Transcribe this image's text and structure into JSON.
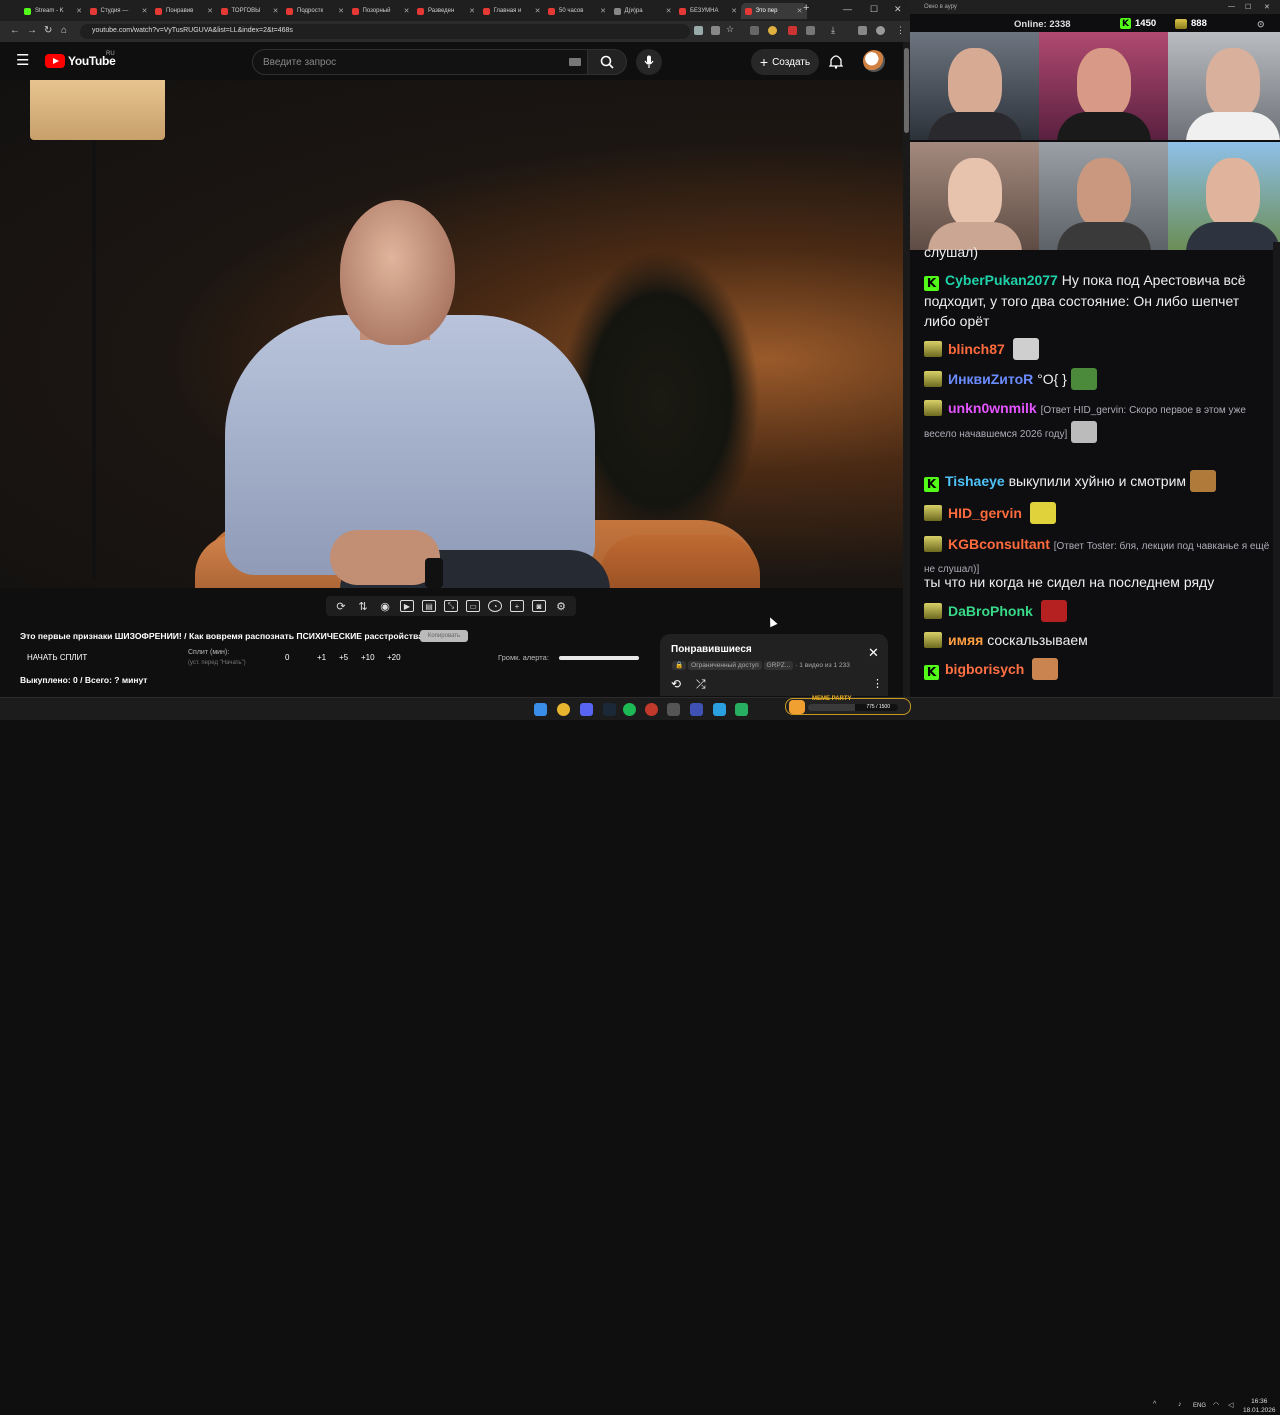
{
  "browser": {
    "tabs": [
      {
        "label": "Stream - K",
        "color": "#53fc18"
      },
      {
        "label": "Студия —",
        "color": "#e53935"
      },
      {
        "label": "Понравив",
        "color": "#e53935"
      },
      {
        "label": "ТОРГОВЫ",
        "color": "#e53935"
      },
      {
        "label": "Подростк",
        "color": "#e53935"
      },
      {
        "label": "Позорный",
        "color": "#e53935"
      },
      {
        "label": "Разведен",
        "color": "#e53935"
      },
      {
        "label": "Главная и",
        "color": "#e53935"
      },
      {
        "label": "50 часов",
        "color": "#e53935"
      },
      {
        "label": "Д(и)ра",
        "color": "#888888"
      },
      {
        "label": "БЕЗУМНА",
        "color": "#e53935"
      },
      {
        "label": "Это пер",
        "color": "#e53935"
      }
    ],
    "url": "youtube.com/watch?v=VyTusRUGUVA&list=LL&index=2&t=468s"
  },
  "youtube": {
    "logo_text": "YouTube",
    "region": "RU",
    "search_placeholder": "Введите запрос",
    "create_label": "Создать"
  },
  "overlay": {
    "title": "Это первые признаки ШИЗОФРЕНИИ! / Как вовремя распознать ПСИХИЧЕСКИЕ расстройства?",
    "copy_label": "Копировать",
    "start_split": "НАЧАТЬ СПЛИТ",
    "split_label": "Сплит (мин):",
    "split_hint": "(уст. перед \"Начать\")",
    "split_values": [
      "0",
      "+1",
      "+5",
      "+10",
      "+20"
    ],
    "alert_label": "Громк. алерта:",
    "alert_volume": 1.0,
    "bought": "Выкуплено: 0 / Всего: ? минут"
  },
  "playlist": {
    "title": "Понравившиеся",
    "access": "Ограниченный доступ",
    "owner": "GRPZ...",
    "position": "1 видео из 1 233"
  },
  "stream": {
    "window_title": "Окно в ауру",
    "online_label": "Online:",
    "online_count": "2338",
    "kick_count": "1450",
    "gold_count": "888",
    "chat": [
      {
        "kind": "continuation",
        "text": "слушал)"
      },
      {
        "kind": "kick",
        "name": "CyberPukan2077",
        "color": "#1fd1a8",
        "text": "Ну пока под Арестовича всё подходит, у того два состояние: Он либо шепчет либо орёт"
      },
      {
        "kind": "gold",
        "name": "blinch87",
        "color": "#ff6b3d",
        "text": ""
      },
      {
        "kind": "gold",
        "name": "ИнквиZитоR",
        "color": "#6b8cff",
        "text": "°O{ }"
      },
      {
        "kind": "gold",
        "name": "unkn0wnmilk",
        "color": "#e455ff",
        "reply": "[Ответ HID_gervin: Скоро первое в этом уже весело начавшемся 2026 году]",
        "text": ""
      },
      {
        "kind": "kick",
        "name": "Tishaeye",
        "color": "#4fc3f7",
        "text": "выкупили хуйню и смотрим"
      },
      {
        "kind": "gold",
        "name": "HID_gervin",
        "color": "#ff6b3d",
        "text": ""
      },
      {
        "kind": "gold",
        "name": "KGBconsultant",
        "color": "#ff6b3d",
        "reply": "[Ответ Toster: бля, лекции под чавканье я ещё не слушал)]",
        "text": ""
      },
      {
        "kind": "plain",
        "text": "ты что ни когда не сидел на последнем ряду"
      },
      {
        "kind": "gold",
        "name": "DaBroPhonk",
        "color": "#39d98a",
        "text": ""
      },
      {
        "kind": "gold",
        "name": "имяя",
        "color": "#ff9f43",
        "text": "соскальзываем"
      },
      {
        "kind": "kick",
        "name": "bigborisych",
        "color": "#ff7043",
        "text": ""
      }
    ]
  },
  "taskbar": {
    "meme_title": "MEME PARTY",
    "meme_progress": "775 / 1500",
    "meme_fraction": 0.52,
    "lang": "ENG",
    "time": "16:36",
    "date": "18.01.2026"
  }
}
